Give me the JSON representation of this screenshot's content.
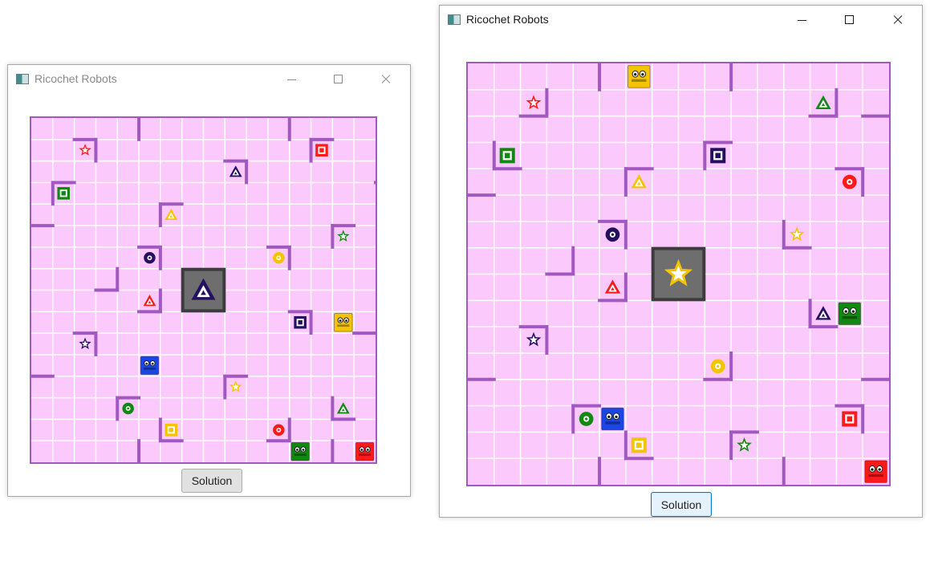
{
  "colors": {
    "board_bg": "#fbc9fb",
    "grid_line": "#ffffff",
    "wall": "#a159c1",
    "center_fill": "#6e6e6e",
    "center_border": "#3c3c3c",
    "red": "#ff1a1a",
    "green": "#118811",
    "blue": "#1a46e6",
    "yellow": "#f5c400",
    "navy": "#241060"
  },
  "windows": [
    {
      "title": "Ricochet Robots",
      "active": false,
      "solution_label": "Solution",
      "board": {
        "size": 16,
        "center_icon": {
          "shape": "triangle",
          "color": "navy"
        },
        "walls": [
          [
            5,
            0,
            "v"
          ],
          [
            12,
            0,
            "v"
          ],
          [
            2,
            1,
            "h"
          ],
          [
            3,
            1,
            "v"
          ],
          [
            13,
            1,
            "h"
          ],
          [
            13,
            1,
            "v"
          ],
          [
            9,
            2,
            "h"
          ],
          [
            10,
            2,
            "v"
          ],
          [
            1,
            3,
            "h"
          ],
          [
            1,
            3,
            "v"
          ],
          [
            16,
            3,
            "h"
          ],
          [
            6,
            4,
            "h"
          ],
          [
            6,
            4,
            "v"
          ],
          [
            0,
            5,
            "h"
          ],
          [
            14,
            5,
            "h"
          ],
          [
            14,
            5,
            "v"
          ],
          [
            5,
            6,
            "h"
          ],
          [
            6,
            6,
            "v"
          ],
          [
            11,
            6,
            "h"
          ],
          [
            12,
            6,
            "v"
          ],
          [
            4,
            7,
            "v"
          ],
          [
            3,
            8,
            "h"
          ],
          [
            6,
            8,
            "v"
          ],
          [
            5,
            9,
            "h"
          ],
          [
            12,
            9,
            "h"
          ],
          [
            13,
            9,
            "v"
          ],
          [
            2,
            10,
            "h"
          ],
          [
            3,
            10,
            "v"
          ],
          [
            15,
            10,
            "h"
          ],
          [
            0,
            12,
            "h"
          ],
          [
            9,
            12,
            "h"
          ],
          [
            9,
            12,
            "v"
          ],
          [
            4,
            13,
            "h"
          ],
          [
            4,
            13,
            "v"
          ],
          [
            14,
            13,
            "v"
          ],
          [
            14,
            14,
            "h"
          ],
          [
            6,
            14,
            "v"
          ],
          [
            6,
            15,
            "h"
          ],
          [
            12,
            14,
            "v"
          ],
          [
            11,
            15,
            "h"
          ],
          [
            5,
            15,
            "v"
          ],
          [
            14,
            15,
            "v"
          ]
        ],
        "targets": [
          {
            "row": 1,
            "col": 2,
            "shape": "star",
            "color": "red"
          },
          {
            "row": 1,
            "col": 13,
            "shape": "square",
            "color": "red"
          },
          {
            "row": 2,
            "col": 9,
            "shape": "triangle",
            "color": "navy"
          },
          {
            "row": 3,
            "col": 1,
            "shape": "square",
            "color": "green"
          },
          {
            "row": 4,
            "col": 6,
            "shape": "triangle",
            "color": "yellow"
          },
          {
            "row": 5,
            "col": 14,
            "shape": "star",
            "color": "green"
          },
          {
            "row": 6,
            "col": 5,
            "shape": "circle",
            "color": "navy"
          },
          {
            "row": 6,
            "col": 11,
            "shape": "circle",
            "color": "yellow"
          },
          {
            "row": 8,
            "col": 5,
            "shape": "triangle",
            "color": "red"
          },
          {
            "row": 9,
            "col": 12,
            "shape": "square",
            "color": "navy"
          },
          {
            "row": 10,
            "col": 2,
            "shape": "star",
            "color": "navy"
          },
          {
            "row": 12,
            "col": 9,
            "shape": "star",
            "color": "yellow"
          },
          {
            "row": 13,
            "col": 4,
            "shape": "circle",
            "color": "green"
          },
          {
            "row": 13,
            "col": 14,
            "shape": "triangle",
            "color": "green"
          },
          {
            "row": 14,
            "col": 6,
            "shape": "square",
            "color": "yellow"
          },
          {
            "row": 14,
            "col": 11,
            "shape": "circle",
            "color": "red"
          }
        ],
        "robots": [
          {
            "row": 9,
            "col": 14,
            "color": "yellow"
          },
          {
            "row": 11,
            "col": 5,
            "color": "blue"
          },
          {
            "row": 15,
            "col": 12,
            "color": "green"
          },
          {
            "row": 15,
            "col": 15,
            "color": "red"
          }
        ]
      }
    },
    {
      "title": "Ricochet Robots",
      "active": true,
      "solution_label": "Solution",
      "board": {
        "size": 16,
        "center_icon": {
          "shape": "star",
          "color": "yellow"
        },
        "walls": [
          [
            5,
            0,
            "v"
          ],
          [
            10,
            0,
            "v"
          ],
          [
            2,
            2,
            "h"
          ],
          [
            3,
            1,
            "v"
          ],
          [
            13,
            2,
            "h"
          ],
          [
            14,
            1,
            "v"
          ],
          [
            15,
            2,
            "h"
          ],
          [
            1,
            4,
            "h"
          ],
          [
            1,
            3,
            "v"
          ],
          [
            9,
            3,
            "h"
          ],
          [
            9,
            3,
            "v"
          ],
          [
            6,
            4,
            "h"
          ],
          [
            6,
            4,
            "v"
          ],
          [
            14,
            4,
            "h"
          ],
          [
            15,
            4,
            "v"
          ],
          [
            0,
            5,
            "h"
          ],
          [
            5,
            6,
            "h"
          ],
          [
            6,
            6,
            "v"
          ],
          [
            12,
            6,
            "v"
          ],
          [
            12,
            7,
            "h"
          ],
          [
            3,
            8,
            "h"
          ],
          [
            4,
            7,
            "v"
          ],
          [
            6,
            8,
            "v"
          ],
          [
            5,
            9,
            "h"
          ],
          [
            13,
            9,
            "v"
          ],
          [
            13,
            10,
            "h"
          ],
          [
            2,
            10,
            "h"
          ],
          [
            3,
            10,
            "v"
          ],
          [
            10,
            11,
            "v"
          ],
          [
            9,
            12,
            "h"
          ],
          [
            15,
            12,
            "h"
          ],
          [
            0,
            12,
            "h"
          ],
          [
            4,
            13,
            "h"
          ],
          [
            4,
            13,
            "v"
          ],
          [
            14,
            13,
            "h"
          ],
          [
            15,
            13,
            "v"
          ],
          [
            6,
            14,
            "v"
          ],
          [
            6,
            15,
            "h"
          ],
          [
            10,
            14,
            "h"
          ],
          [
            10,
            14,
            "v"
          ],
          [
            5,
            15,
            "v"
          ],
          [
            12,
            15,
            "v"
          ]
        ],
        "targets": [
          {
            "row": 1,
            "col": 2,
            "shape": "star",
            "color": "red"
          },
          {
            "row": 1,
            "col": 13,
            "shape": "triangle",
            "color": "green"
          },
          {
            "row": 3,
            "col": 1,
            "shape": "square",
            "color": "green"
          },
          {
            "row": 3,
            "col": 9,
            "shape": "square",
            "color": "navy"
          },
          {
            "row": 4,
            "col": 6,
            "shape": "triangle",
            "color": "yellow"
          },
          {
            "row": 4,
            "col": 14,
            "shape": "circle",
            "color": "red"
          },
          {
            "row": 6,
            "col": 5,
            "shape": "circle",
            "color": "navy"
          },
          {
            "row": 6,
            "col": 12,
            "shape": "star",
            "color": "yellow"
          },
          {
            "row": 8,
            "col": 5,
            "shape": "triangle",
            "color": "red"
          },
          {
            "row": 9,
            "col": 13,
            "shape": "triangle",
            "color": "navy"
          },
          {
            "row": 10,
            "col": 2,
            "shape": "star",
            "color": "navy"
          },
          {
            "row": 11,
            "col": 9,
            "shape": "circle",
            "color": "yellow"
          },
          {
            "row": 13,
            "col": 4,
            "shape": "circle",
            "color": "green"
          },
          {
            "row": 13,
            "col": 14,
            "shape": "square",
            "color": "red"
          },
          {
            "row": 14,
            "col": 6,
            "shape": "square",
            "color": "yellow"
          },
          {
            "row": 14,
            "col": 10,
            "shape": "star",
            "color": "green"
          }
        ],
        "robots": [
          {
            "row": 0,
            "col": 6,
            "color": "yellow"
          },
          {
            "row": 9,
            "col": 14,
            "color": "green"
          },
          {
            "row": 13,
            "col": 5,
            "color": "blue"
          },
          {
            "row": 15,
            "col": 15,
            "color": "red"
          }
        ]
      }
    }
  ]
}
